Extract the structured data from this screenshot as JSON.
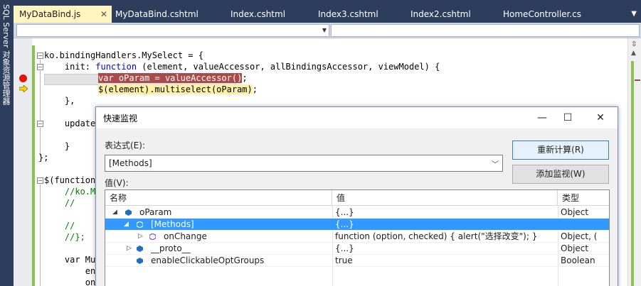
{
  "side_panel": {
    "label": "SQL Server 对象资源管理器"
  },
  "tabs": [
    {
      "label": "MyDataBind.js",
      "active": true,
      "pinned": true
    },
    {
      "label": "MyDataBind.cshtml"
    },
    {
      "label": "Index.cshtml"
    },
    {
      "label": "Index3.cshtml"
    },
    {
      "label": "Index2.cshtml"
    },
    {
      "label": "HomeController.cs"
    }
  ],
  "tab_close_glyph": "✕",
  "tab_overflow_glyph": "▼",
  "code_lines": {
    "l1": "ko.bindingHandlers.MySelect = {",
    "l2_pre": "    init: ",
    "l2_kw": "function",
    "l2_post": " (element, valueAccessor, allBindingsAccessor, viewModel) {",
    "l3_kw": "var",
    "l3_var": "oParam",
    "l3_post": " = valueAccessor()",
    "l3_end": ";",
    "l4": "$(element).multiselect(oParam)",
    "l4_end": ";",
    "l5": "    },",
    "l6": "    update",
    "l7": "    }",
    "l8": "};",
    "l9": "$(function",
    "l10": "    //ko.M",
    "l11": "    //   ",
    "l12": "    //",
    "l13": "    //};",
    "l14": "    var Mu",
    "l15": "        en",
    "l16": "        on"
  },
  "dialog": {
    "title": "快速监视",
    "minimize": "—",
    "maximize": "☐",
    "close": "✕",
    "expression_label": "表达式(E):",
    "expression_value": "[Methods]",
    "recalculate_button": "重新计算(R)",
    "add_watch_button": "添加监视(W)",
    "value_label": "值(V):",
    "columns": {
      "name": "名称",
      "value": "值",
      "type": "类型"
    },
    "rows": [
      {
        "name": "oParam",
        "value": "{...}",
        "type": "Object",
        "expander": "◢",
        "indent": 0
      },
      {
        "name": "[Methods]",
        "value": "{...}",
        "type": "",
        "expander": "◢",
        "indent": 1,
        "selected": true
      },
      {
        "name": "onChange",
        "value": "function (option, checked) {           alert(\"选择改变\");       }",
        "type": "Object, (",
        "expander": "▷",
        "indent": 2
      },
      {
        "name": "__proto__",
        "value": "{...}",
        "type": "Object",
        "expander": "▷",
        "indent": 1
      },
      {
        "name": "enableClickableOptGroups",
        "value": "true",
        "type": "Boolean",
        "expander": "",
        "indent": 1
      }
    ]
  },
  "colors": {
    "chrome": "#2d3e5d",
    "active_tab": "#fdf4bf",
    "selection": "#3399ff",
    "breakpoint": "#e51400",
    "change_bar": "#8cc152"
  }
}
